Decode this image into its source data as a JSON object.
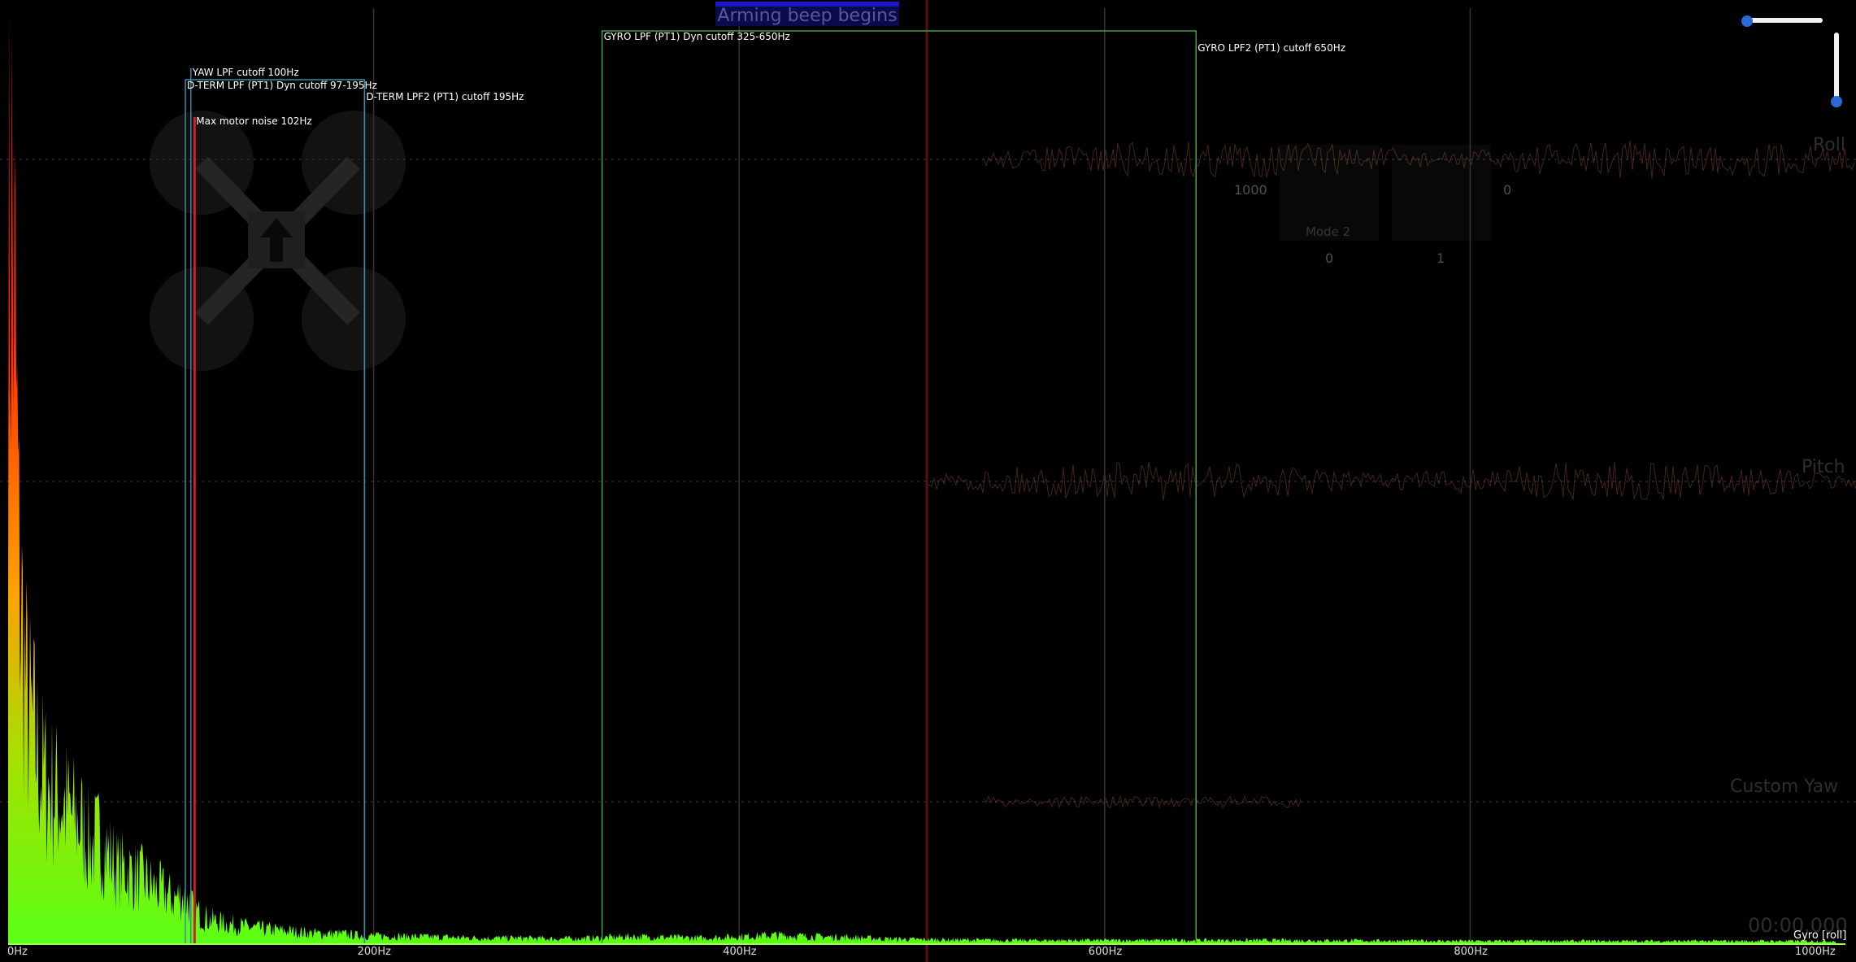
{
  "chart_data": {
    "type": "area",
    "title": "",
    "series_label": "Gyro [roll]",
    "xlim": [
      0,
      1000
    ],
    "x_ticks": [
      "0Hz",
      "200Hz",
      "400Hz",
      "600Hz",
      "800Hz",
      "1000Hz"
    ],
    "x_tick_values": [
      0,
      200,
      400,
      600,
      800,
      1000
    ],
    "gradient_colors": [
      "#ff2020",
      "#ff2a00",
      "#ffa000",
      "#a6e000",
      "#5bff15"
    ],
    "spectrum": {
      "x": [
        0,
        1,
        2,
        4,
        6,
        8,
        10,
        12,
        15,
        18,
        22,
        26,
        30,
        35,
        40,
        45,
        50,
        55,
        60,
        65,
        70,
        75,
        80,
        85,
        90,
        95,
        100,
        105,
        110,
        120,
        130,
        140,
        150,
        160,
        170,
        180,
        190,
        200,
        220,
        240,
        260,
        280,
        300,
        320,
        340,
        360,
        380,
        400,
        420,
        440,
        460,
        480,
        500,
        550,
        600,
        650,
        700,
        800,
        900,
        1000
      ],
      "y": [
        1.0,
        0.99,
        0.97,
        0.78,
        0.5,
        0.41,
        0.33,
        0.3,
        0.27,
        0.23,
        0.21,
        0.2,
        0.19,
        0.17,
        0.16,
        0.13,
        0.14,
        0.12,
        0.1,
        0.1,
        0.09,
        0.085,
        0.075,
        0.07,
        0.06,
        0.065,
        0.05,
        0.04,
        0.033,
        0.027,
        0.023,
        0.02,
        0.018,
        0.016,
        0.014,
        0.014,
        0.012,
        0.011,
        0.01,
        0.009,
        0.008,
        0.008,
        0.007,
        0.008,
        0.01,
        0.009,
        0.008,
        0.01,
        0.012,
        0.01,
        0.009,
        0.007,
        0.006,
        0.005,
        0.005,
        0.005,
        0.005,
        0.004,
        0.004,
        0.004
      ]
    },
    "filter_markers": [
      {
        "label": "YAW LPF cutoff 100Hz",
        "hz": 100,
        "color": "#4a7da0"
      },
      {
        "label": "D-TERM LPF (PT1) Dyn cutoff 97-195Hz",
        "hz_range": [
          97,
          195
        ],
        "color": "#3a8aa8"
      },
      {
        "label": "D-TERM LPF2 (PT1) cutoff 195Hz",
        "hz": 195,
        "color": "#3a8aa8"
      },
      {
        "label": "Max motor noise 102Hz",
        "hz": 102,
        "color": "#d02020"
      },
      {
        "label": "GYRO LPF (PT1) Dyn cutoff 325-650Hz",
        "hz_range": [
          325,
          650
        ],
        "color": "#4f9a4f"
      },
      {
        "label": "GYRO LPF2 (PT1) cutoff 650Hz",
        "hz": 650,
        "color": "#4f9a4f"
      }
    ]
  },
  "event_flag": {
    "label": "Arming beep begins"
  },
  "overlay": {
    "trace_labels": [
      "Roll",
      "Pitch",
      "Custom Yaw"
    ],
    "stick_values": {
      "left_top": "1000",
      "right_top": "0",
      "left_bottom": "0",
      "right_bottom": "1"
    },
    "mode_label": "Mode 2",
    "time_display": "00:00.000"
  },
  "controls": {
    "zoom_slider_value": 0.0,
    "vertical_slider_value": 1.0
  }
}
